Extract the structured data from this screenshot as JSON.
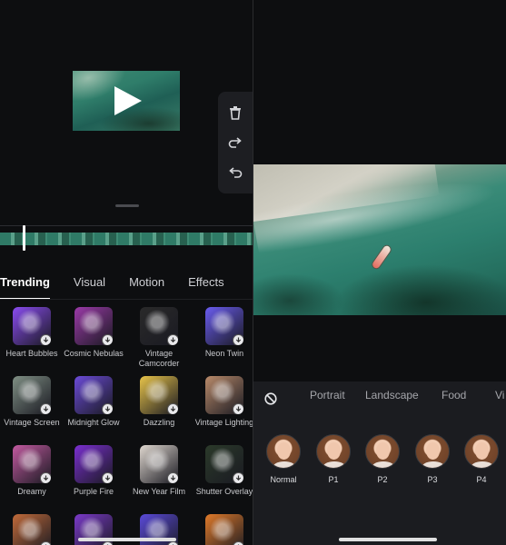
{
  "left": {
    "tabs": [
      {
        "label": "Trending",
        "active": true
      },
      {
        "label": "Visual",
        "active": false
      },
      {
        "label": "Motion",
        "active": false
      },
      {
        "label": "Effects",
        "active": false
      }
    ],
    "toolbar_icons": [
      "trash-icon",
      "redo-icon",
      "undo-icon"
    ],
    "effects": [
      {
        "label": "Heart Bubbles",
        "icon": "heart-bubbles-thumb"
      },
      {
        "label": "Cosmic Nebulas",
        "icon": "cosmic-nebulas-thumb"
      },
      {
        "label": "Vintage Camcorder",
        "icon": "vintage-camcorder-thumb"
      },
      {
        "label": "Neon Twin",
        "icon": "neon-twin-thumb"
      },
      {
        "label": "Vintage Screen",
        "icon": "vintage-screen-thumb"
      },
      {
        "label": "Midnight Glow",
        "icon": "midnight-glow-thumb"
      },
      {
        "label": "Dazzling",
        "icon": "dazzling-thumb"
      },
      {
        "label": "Vintage Lighting",
        "icon": "vintage-lighting-thumb"
      },
      {
        "label": "Dreamy",
        "icon": "dreamy-thumb"
      },
      {
        "label": "Purple Fire",
        "icon": "purple-fire-thumb"
      },
      {
        "label": "New Year Film",
        "icon": "new-year-film-thumb"
      },
      {
        "label": "Shutter Overlay",
        "icon": "shutter-overlay-thumb"
      },
      {
        "label": "",
        "icon": "effect-thumb"
      },
      {
        "label": "",
        "icon": "effect-thumb"
      },
      {
        "label": "",
        "icon": "effect-thumb"
      },
      {
        "label": "",
        "icon": "effect-thumb"
      }
    ],
    "thumb_colors": [
      "#8a4cf0",
      "#9b3aa8",
      "#2a2a2a",
      "#6a5cf0",
      "#7f8f84",
      "#6b4bd8",
      "#e8c44a",
      "#b98a6a",
      "#c25aa0",
      "#7a2fd0",
      "#e0d8d0",
      "#2b3a2a",
      "#c06a3a",
      "#7a3ac8",
      "#5a4ad8",
      "#e07a2a"
    ]
  },
  "right": {
    "filter_tabs": [
      "Portrait",
      "Landscape",
      "Food",
      "Vi"
    ],
    "filters": [
      {
        "label": "Normal"
      },
      {
        "label": "P1"
      },
      {
        "label": "P2"
      },
      {
        "label": "P3"
      },
      {
        "label": "P4"
      }
    ]
  }
}
